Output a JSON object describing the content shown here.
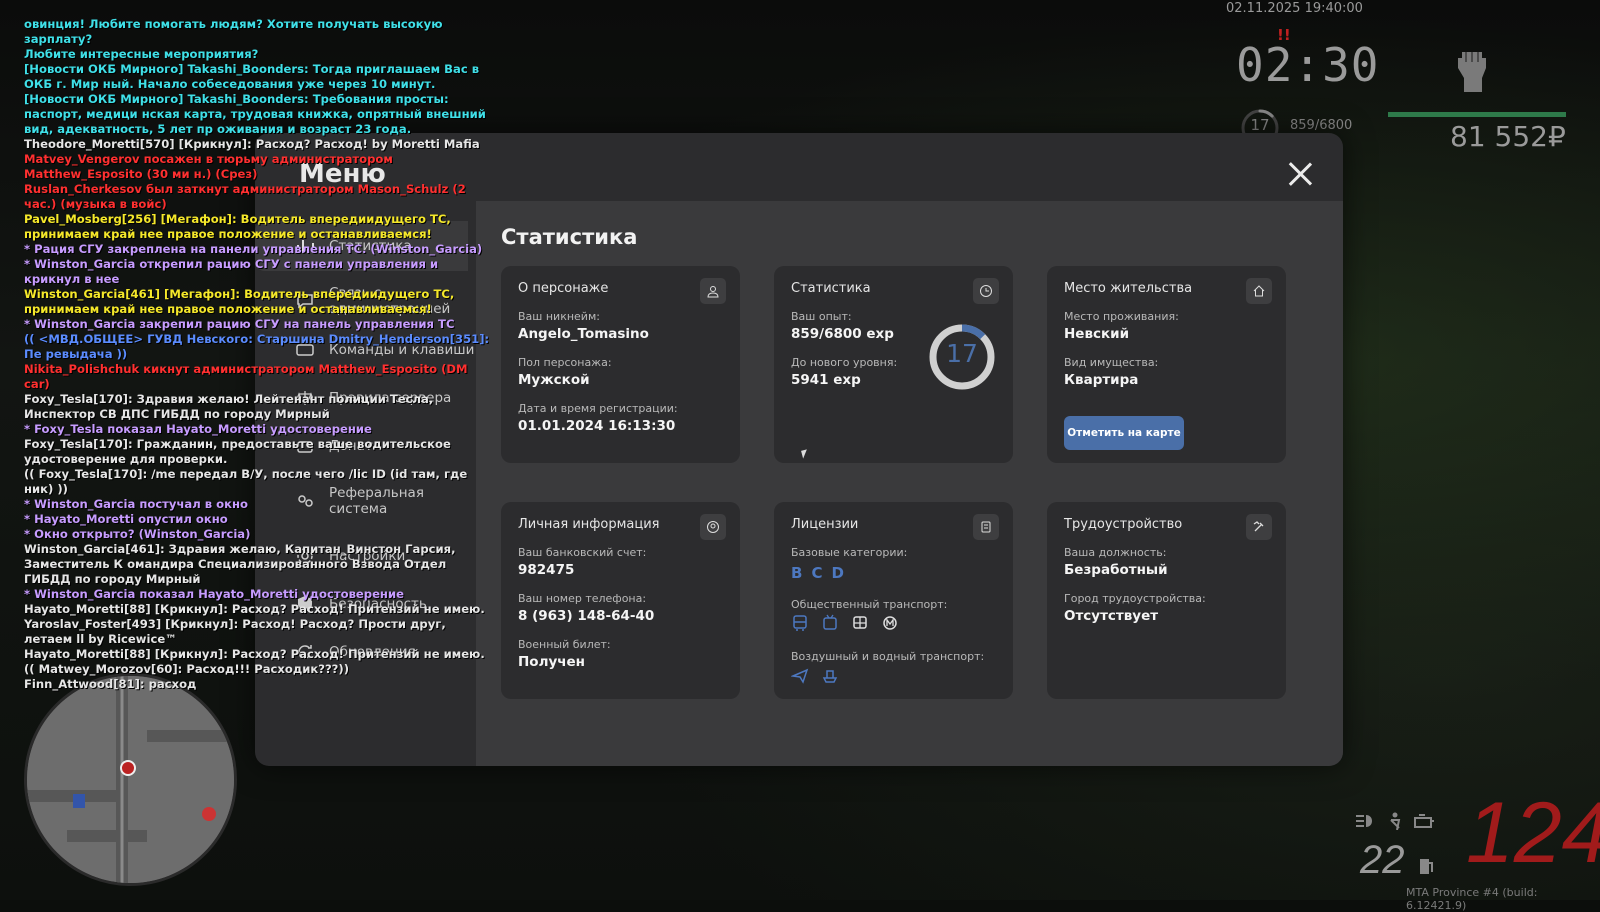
{
  "hud": {
    "datetime": "02.11.2025 19:40:00",
    "time": "02:30",
    "exclaim": "!!",
    "level": "17",
    "exp": "859/6800",
    "money": "81 552₽",
    "speed": "124",
    "fuel": "22",
    "build": "MTA Province #4 (build: 6.12421.9)",
    "colors": {
      "hp": "#2e7a4a",
      "speed": "#a11b1b",
      "accent": "#4a6fa8"
    }
  },
  "chat": [
    {
      "text": "овинция! Любите помогать людям? Хотите получать высокую зарплату?",
      "color": "#3fe0e8"
    },
    {
      "text": " Любите интересные мероприятия?",
      "color": "#3fe0e8"
    },
    {
      "text": "[Новости ОКБ Мирного] Takashi_Boonders: Тогда приглашаем Вас в ОКБ г. Мир ный. Начало собеседования уже через 10 минут.",
      "color": "#3fe0e8"
    },
    {
      "text": "[Новости ОКБ Мирного] Takashi_Boonders: Требования просты: паспорт, медици нская карта, трудовая книжка, опрятный внешний вид, адекватность, 5 лет пр оживания и возраст 23 года.",
      "color": "#3fe0e8"
    },
    {
      "text": "Theodore_Moretti[570] [Крикнул]: Расход? Расход! by Moretti Mafia",
      "color": "#e6e6e6"
    },
    {
      "text": "Matvey_Vengerov посажен в тюрьму администратором Matthew_Esposito (30 ми н.) (Срез)",
      "color": "#ff3030"
    },
    {
      "text": "Ruslan_Cherkesov был заткнут администратором Mason_Schulz (2 час.) (музыка в войс)",
      "color": "#ff3030"
    },
    {
      "text": "Pavel_Mosberg[256] [Мегафон]: Водитель впередиидущего ТС, принимаем край нее правое положение и останавливаемся!",
      "color": "#f5e82a"
    },
    {
      "text": "* Рация СГУ закреплена на панели управления ТС. (Winston_Garcia)",
      "color": "#c79cff"
    },
    {
      "text": "* Winston_Garcia открепил рацию СГУ с панели управления и крикнул в нее",
      "color": "#c79cff"
    },
    {
      "text": "Winston_Garcia[461] [Мегафон]: Водитель впередиидущего ТС, принимаем край нее правое положение и останавливаемся!",
      "color": "#f5e82a"
    },
    {
      "text": "* Winston_Garcia закрепил рацию СГУ на панель управления ТС",
      "color": "#c79cff"
    },
    {
      "text": "(( <МВД.ОБЩЕЕ> ГУВД Невского: Старшина Dmitry_Henderson[351]: Пе ревыдача ))",
      "color": "#5b8cff"
    },
    {
      "text": "Nikita_Polishchuk кикнут администратором Matthew_Esposito (DM car)",
      "color": "#ff3030"
    },
    {
      "text": "Foxy_Tesla[170]: Здравия желаю! Лейтенант полиции Тесла, Инспектор СВ ДПС ГИБДД по городу Мирный",
      "color": "#e6e6e6"
    },
    {
      "text": "* Foxy_Tesla показал Hayato_Moretti удостоверение",
      "color": "#c79cff"
    },
    {
      "text": "Foxy_Tesla[170]: Гражданин, предоставьте ваше водительское удостоверение для проверки.",
      "color": "#e6e6e6"
    },
    {
      "text": "(( Foxy_Tesla[170]: /me передал В/У, после чего /lic ID (id там, где ник) ))",
      "color": "#e6e6e6"
    },
    {
      "text": "* Winston_Garcia постучал в окно",
      "color": "#c79cff"
    },
    {
      "text": "* Hayato_Moretti опустил окно",
      "color": "#c79cff"
    },
    {
      "text": "* Окно открыто? (Winston_Garcia)",
      "color": "#c79cff"
    },
    {
      "text": "Winston_Garcia[461]: Здравия желаю, Капитан_Винстон Гарсия, Заместитель К омандира Специализированного Взвода Отдел ГИБДД по городу Мирный",
      "color": "#e6e6e6"
    },
    {
      "text": "* Winston_Garcia показал Hayato_Moretti удостоверение",
      "color": "#c79cff"
    },
    {
      "text": "Hayato_Moretti[88] [Крикнул]: Расход? Расход! Притензий не имею.",
      "color": "#e6e6e6"
    },
    {
      "text": "Yaroslav_Foster[493] [Крикнул]: Расход! Расход? Прости друг, летаем ll by Ricewice™",
      "color": "#e6e6e6"
    },
    {
      "text": "Hayato_Moretti[88] [Крикнул]: Расход? Расход! Притензий не имею.",
      "color": "#e6e6e6"
    },
    {
      "text": "(( Matwey_Morozov[60]: Расход!!! Расходик???))",
      "color": "#e6e6e6"
    },
    {
      "text": "Finn_Attwood[81]: расход",
      "color": "#e6e6e6"
    }
  ],
  "menu": {
    "title": "Меню",
    "sidebar": [
      {
        "label": "Статистика",
        "icon": "stats-icon"
      },
      {
        "label": "Связь с администрацией",
        "icon": "chat-icon"
      },
      {
        "label": "Команды и клавиши",
        "icon": "keyboard-icon"
      },
      {
        "label": "Правила сервера",
        "icon": "scales-icon"
      },
      {
        "label": "Донат",
        "icon": "donate-icon"
      },
      {
        "label": "Реферальная система",
        "icon": "referral-icon"
      },
      {
        "label": "Настройки",
        "icon": "gear-icon"
      },
      {
        "label": "Безопасность",
        "icon": "shield-icon"
      },
      {
        "label": "Обновления",
        "icon": "refresh-icon"
      }
    ]
  },
  "content": {
    "title": "Статистика",
    "character": {
      "title": "О персонаже",
      "nick_label": "Ваш никнейм:",
      "nick": "Angelo_Tomasino",
      "gender_label": "Пол персонажа:",
      "gender": "Мужской",
      "reg_label": "Дата и время регистрации:",
      "reg": "01.01.2024 16:13:30"
    },
    "stats": {
      "title": "Статистика",
      "exp_label": "Ваш опыт:",
      "exp": "859/6800 exp",
      "next_label": "До нового уровня:",
      "next": "5941 exp",
      "level": "17",
      "progress": 0.126
    },
    "residence": {
      "title": "Место жительства",
      "place_label": "Место проживания:",
      "place": "Невский",
      "type_label": "Вид имущества:",
      "type": "Квартира",
      "button": "Отметить на карте"
    },
    "personal": {
      "title": "Личная информация",
      "bank_label": "Ваш банковский счет:",
      "bank": "982475",
      "phone_label": "Ваш номер телефона:",
      "phone": "8 (963) 148-64-40",
      "military_label": "Военный билет:",
      "military": "Получен"
    },
    "licenses": {
      "title": "Лицензии",
      "base_label": "Базовые категории:",
      "categories": [
        "B",
        "C",
        "D"
      ],
      "public_label": "Общественный транспорт:",
      "air_label": "Воздушный и водный транспорт:"
    },
    "employment": {
      "title": "Трудоустройство",
      "job_label": "Ваша должность:",
      "job": "Безработный",
      "city_label": "Город трудоустройства:",
      "city": "Отсутствует"
    }
  }
}
